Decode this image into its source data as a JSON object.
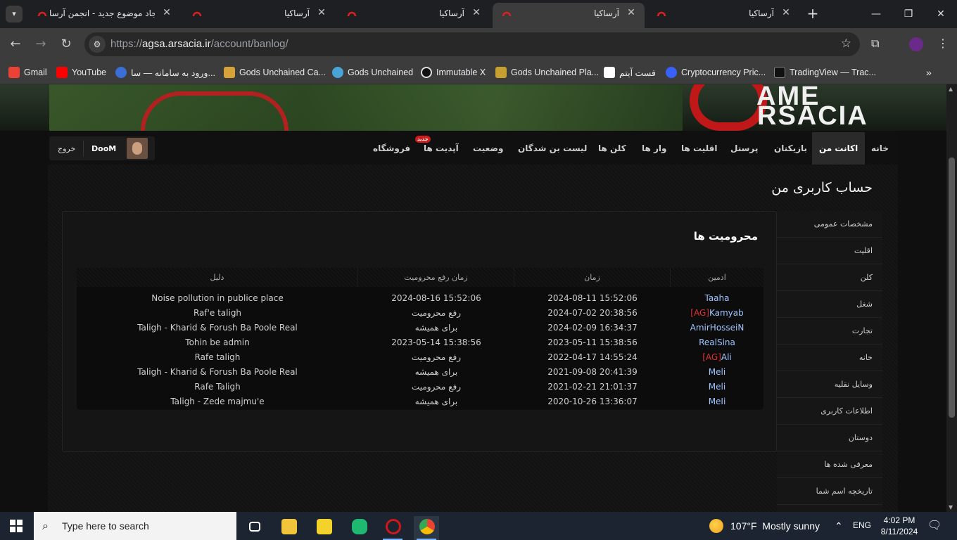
{
  "browser": {
    "tabs": [
      {
        "label": "ایجاد موضوع جدید - انجمن آرسا"
      },
      {
        "label": "آرساکیا"
      },
      {
        "label": "آرساکیا"
      },
      {
        "label": "آرساکیا"
      },
      {
        "label": "آرساکیا"
      }
    ],
    "url_prefix": "https://",
    "url_host": "agsa.arsacia.ir",
    "url_path": "/account/banlog/",
    "bookmarks": [
      {
        "label": "Gmail",
        "color": "#ea4335"
      },
      {
        "label": "YouTube",
        "color": "#ff0000"
      },
      {
        "label": "ورود به سامانه — سا...",
        "color": "#3b6fd8"
      },
      {
        "label": "Gods Unchained Ca...",
        "color": "#d8a23b"
      },
      {
        "label": "Gods Unchained",
        "color": "#4aa3d8"
      },
      {
        "label": "Immutable X",
        "color": "#222222"
      },
      {
        "label": "Gods Unchained Pla...",
        "color": "#c8a030"
      },
      {
        "label": "فست آیتم",
        "color": "#ffffff"
      },
      {
        "label": "Cryptocurrency Pric...",
        "color": "#3861fb"
      },
      {
        "label": "TradingView — Trac...",
        "color": "#111111"
      }
    ]
  },
  "site": {
    "logo_line1": "AME",
    "logo_line2": "RSACIA",
    "nav": {
      "home": "خانه",
      "my_account": "اکانت من",
      "players": "بازیکنان",
      "staff": "پرسنل",
      "minorities": "اقلیت ها",
      "wars": "وار ها",
      "clans": "کلن ها",
      "dead_ends": "لیست بن شدگان",
      "status": "وضعیت",
      "updates": "آپدیت ها",
      "new_badge": "جدید",
      "shop": "فروشگاه"
    },
    "user": {
      "logout": "خروج",
      "name": "DooM"
    }
  },
  "page": {
    "title": "حساب کاربری من",
    "panel_title": "محرومیت ها",
    "sidebar": [
      "مشخصات عمومی",
      "اقلیت",
      "کلن",
      "شغل",
      "تجارت",
      "خانه",
      "وسایل نقلیه",
      "اطلاعات کاربری",
      "دوستان",
      "معرفی شده ها",
      "تاریخچه اسم شما"
    ],
    "table": {
      "headers": {
        "admin": "ادمین",
        "time": "زمان",
        "unban_time": "زمان رفع محرومیت",
        "reason": "دلیل"
      },
      "rows": [
        {
          "tag": "",
          "admin": "Taaha",
          "time": "2024-08-11 15:52:06",
          "unban": "2024-08-16 15:52:06",
          "reason": "Noise pollution in publice place"
        },
        {
          "tag": "[AG]",
          "admin": "Kamyab",
          "time": "2024-07-02 20:38:56",
          "unban": "رفع محرومیت",
          "reason": "Raf'e taligh"
        },
        {
          "tag": "",
          "admin": "AmirHosseiN",
          "time": "2024-02-09 16:34:37",
          "unban": "برای همیشه",
          "reason": "Taligh - Kharid & Forush Ba Poole Real"
        },
        {
          "tag": "",
          "admin": "RealSina",
          "time": "2023-05-11 15:38:56",
          "unban": "2023-05-14 15:38:56",
          "reason": "Tohin be admin"
        },
        {
          "tag": "[AG]",
          "admin": "Ali",
          "time": "2022-04-17 14:55:24",
          "unban": "رفع محرومیت",
          "reason": "Rafe taligh"
        },
        {
          "tag": "",
          "admin": "Meli",
          "time": "2021-09-08 20:41:39",
          "unban": "برای همیشه",
          "reason": "Taligh - Kharid & Forush Ba Poole Real"
        },
        {
          "tag": "",
          "admin": "Meli",
          "time": "2021-02-21 21:01:37",
          "unban": "رفع محرومیت",
          "reason": "Rafe Taligh"
        },
        {
          "tag": "",
          "admin": "MeIi",
          "time": "2020-10-26 13:36:07",
          "unban": "برای همیشه",
          "reason": "Taligh - Zede majmu'e"
        }
      ]
    }
  },
  "taskbar": {
    "search_placeholder": "Type here to search",
    "weather_temp": "107°F",
    "weather_text": "Mostly sunny",
    "lang": "ENG",
    "time": "4:02 PM",
    "date": "8/11/2024"
  }
}
